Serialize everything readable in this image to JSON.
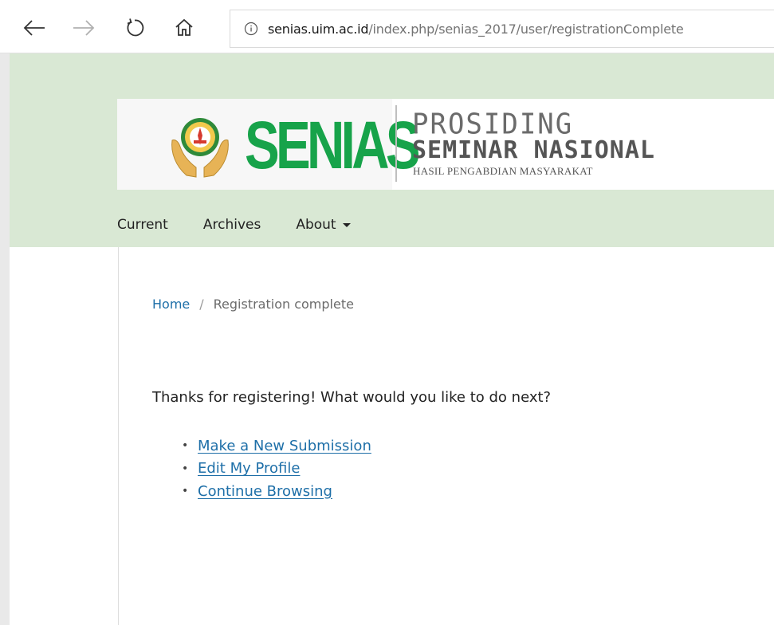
{
  "browser": {
    "url_domain": "senias.uim.ac.id",
    "url_path": "/index.php/senias_2017/user/registrationComplete"
  },
  "banner": {
    "logo_text": "SENIAS",
    "title_line1": "PROSIDING",
    "title_line2": "SEMINAR NASIONAL",
    "title_line3": "HASIL PENGABDIAN MASYARAKAT"
  },
  "nav": {
    "items": [
      {
        "label": "Current"
      },
      {
        "label": "Archives"
      },
      {
        "label": "About"
      }
    ]
  },
  "breadcrumb": {
    "home": "Home",
    "separator": "/",
    "current": "Registration complete"
  },
  "main": {
    "intro": "Thanks for registering! What would you like to do next?",
    "links": [
      {
        "label": "Make a New Submission"
      },
      {
        "label": "Edit My Profile"
      },
      {
        "label": "Continue Browsing"
      }
    ]
  },
  "colors": {
    "header_bg": "#d9e8d4",
    "logo_green": "#17a34a",
    "link_blue": "#1e6fa8"
  }
}
